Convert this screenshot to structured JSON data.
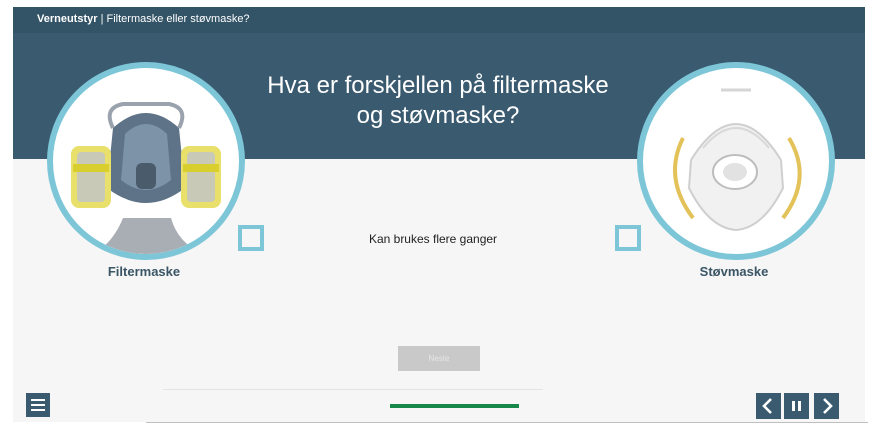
{
  "header": {
    "course": "Verneutstyr",
    "separator": " | ",
    "topic": "Filtermaske eller støvmaske?"
  },
  "question": "Hva er forskjellen på filtermaske og støvmaske?",
  "options": {
    "left": {
      "label": "Filtermaske",
      "image": "half-face respirator with yellow filter cartridges"
    },
    "right": {
      "label": "Støvmaske",
      "image": "white disposable dust mask with valve"
    }
  },
  "statement": "Kan brukes flere ganger",
  "next_button": "Neste",
  "progress": {
    "fraction": 0.34
  },
  "icons": {
    "menu": "menu-icon",
    "prev": "chevron-left-icon",
    "pause": "pause-icon",
    "next": "chevron-right-icon"
  },
  "colors": {
    "header": "#3a5a70",
    "accent": "#7dc6d8",
    "progress": "#18874a",
    "label": "#3a5566"
  }
}
